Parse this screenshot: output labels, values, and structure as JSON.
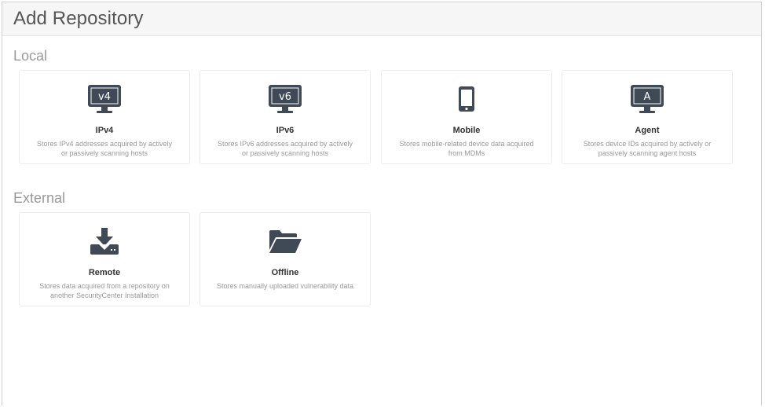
{
  "page": {
    "title": "Add Repository"
  },
  "sections": {
    "local": {
      "title": "Local",
      "tiles": [
        {
          "icon": "monitor-icon",
          "icon_text": "v4",
          "title": "IPv4",
          "desc_line1": "Stores IPv4 addresses acquired by actively",
          "desc_line2": "or passively scanning hosts"
        },
        {
          "icon": "monitor-icon",
          "icon_text": "v6",
          "title": "IPv6",
          "desc_line1": "Stores IPv6 addresses acquired by actively",
          "desc_line2": "or passively scanning hosts"
        },
        {
          "icon": "mobile-phone-icon",
          "title": "Mobile",
          "desc_line1": "Stores mobile-related device data acquired",
          "desc_line2": "from MDMs"
        },
        {
          "icon": "monitor-icon",
          "icon_text": "A",
          "title": "Agent",
          "desc_line1": "Stores device IDs acquired by actively or",
          "desc_line2": "passively scanning agent hosts"
        }
      ]
    },
    "external": {
      "title": "External",
      "tiles": [
        {
          "icon": "download-icon",
          "title": "Remote",
          "desc_line1": "Stores data acquired from a repository on",
          "desc_line2": "another SecurityCenter Installation"
        },
        {
          "icon": "folder-open-icon",
          "title": "Offline",
          "desc_line1": "Stores manually uploaded vulnerability data",
          "desc_line2": ""
        }
      ]
    }
  },
  "colors": {
    "icon": "#3f4a56",
    "header_bg": "#f6f6f6",
    "section_text": "#999999"
  }
}
